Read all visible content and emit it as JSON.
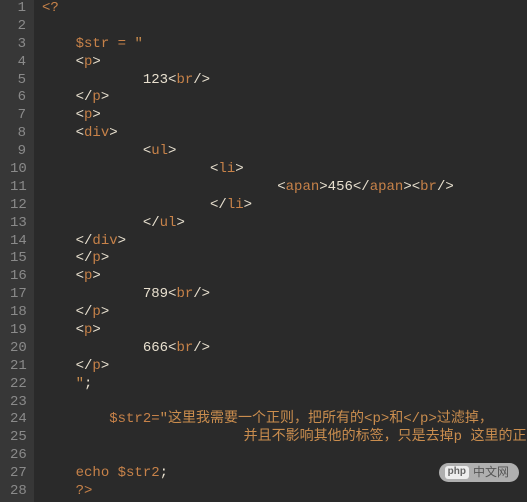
{
  "lines": [
    {
      "n": "1",
      "segments": [
        {
          "t": "<?",
          "c": "tag-name"
        }
      ],
      "indent": 0
    },
    {
      "n": "2",
      "segments": [],
      "indent": 0
    },
    {
      "n": "3",
      "segments": [
        {
          "t": "$str",
          "c": "variable"
        },
        {
          "t": " ",
          "c": ""
        },
        {
          "t": "=",
          "c": "operator"
        },
        {
          "t": " ",
          "c": ""
        },
        {
          "t": "\"",
          "c": "string"
        }
      ],
      "indent": 1
    },
    {
      "n": "4",
      "segments": [
        {
          "t": "<",
          "c": "tag-delim"
        },
        {
          "t": "p",
          "c": "tag-name"
        },
        {
          "t": ">",
          "c": "tag-delim"
        }
      ],
      "indent": 1
    },
    {
      "n": "5",
      "segments": [
        {
          "t": "123",
          "c": "num"
        },
        {
          "t": "<",
          "c": "tag-delim"
        },
        {
          "t": "br",
          "c": "tag-name"
        },
        {
          "t": "/>",
          "c": "tag-delim"
        }
      ],
      "indent": 3
    },
    {
      "n": "6",
      "segments": [
        {
          "t": "</",
          "c": "tag-delim"
        },
        {
          "t": "p",
          "c": "tag-name"
        },
        {
          "t": ">",
          "c": "tag-delim"
        }
      ],
      "indent": 1
    },
    {
      "n": "7",
      "segments": [
        {
          "t": "<",
          "c": "tag-delim"
        },
        {
          "t": "p",
          "c": "tag-name"
        },
        {
          "t": ">",
          "c": "tag-delim"
        }
      ],
      "indent": 1
    },
    {
      "n": "8",
      "segments": [
        {
          "t": "<",
          "c": "tag-delim"
        },
        {
          "t": "div",
          "c": "tag-name"
        },
        {
          "t": ">",
          "c": "tag-delim"
        }
      ],
      "indent": 1
    },
    {
      "n": "9",
      "segments": [
        {
          "t": "<",
          "c": "tag-delim"
        },
        {
          "t": "ul",
          "c": "tag-name"
        },
        {
          "t": ">",
          "c": "tag-delim"
        }
      ],
      "indent": 3
    },
    {
      "n": "10",
      "segments": [
        {
          "t": "<",
          "c": "tag-delim"
        },
        {
          "t": "li",
          "c": "tag-name"
        },
        {
          "t": ">",
          "c": "tag-delim"
        }
      ],
      "indent": 5
    },
    {
      "n": "11",
      "segments": [
        {
          "t": "<",
          "c": "tag-delim"
        },
        {
          "t": "apan",
          "c": "tag-name"
        },
        {
          "t": ">",
          "c": "tag-delim"
        },
        {
          "t": "456",
          "c": "num"
        },
        {
          "t": "</",
          "c": "tag-delim"
        },
        {
          "t": "apan",
          "c": "tag-name"
        },
        {
          "t": ">",
          "c": "tag-delim"
        },
        {
          "t": "<",
          "c": "tag-delim"
        },
        {
          "t": "br",
          "c": "tag-name"
        },
        {
          "t": "/>",
          "c": "tag-delim"
        }
      ],
      "indent": 7
    },
    {
      "n": "12",
      "segments": [
        {
          "t": "</",
          "c": "tag-delim"
        },
        {
          "t": "li",
          "c": "tag-name"
        },
        {
          "t": ">",
          "c": "tag-delim"
        }
      ],
      "indent": 5
    },
    {
      "n": "13",
      "segments": [
        {
          "t": "</",
          "c": "tag-delim"
        },
        {
          "t": "ul",
          "c": "tag-name"
        },
        {
          "t": ">",
          "c": "tag-delim"
        }
      ],
      "indent": 3
    },
    {
      "n": "14",
      "segments": [
        {
          "t": "</",
          "c": "tag-delim"
        },
        {
          "t": "div",
          "c": "tag-name"
        },
        {
          "t": ">",
          "c": "tag-delim"
        }
      ],
      "indent": 1
    },
    {
      "n": "15",
      "segments": [
        {
          "t": "</",
          "c": "tag-delim"
        },
        {
          "t": "p",
          "c": "tag-name"
        },
        {
          "t": ">",
          "c": "tag-delim"
        }
      ],
      "indent": 1
    },
    {
      "n": "16",
      "segments": [
        {
          "t": "<",
          "c": "tag-delim"
        },
        {
          "t": "p",
          "c": "tag-name"
        },
        {
          "t": ">",
          "c": "tag-delim"
        }
      ],
      "indent": 1
    },
    {
      "n": "17",
      "segments": [
        {
          "t": "789",
          "c": "num"
        },
        {
          "t": "<",
          "c": "tag-delim"
        },
        {
          "t": "br",
          "c": "tag-name"
        },
        {
          "t": "/>",
          "c": "tag-delim"
        }
      ],
      "indent": 3
    },
    {
      "n": "18",
      "segments": [
        {
          "t": "</",
          "c": "tag-delim"
        },
        {
          "t": "p",
          "c": "tag-name"
        },
        {
          "t": ">",
          "c": "tag-delim"
        }
      ],
      "indent": 1
    },
    {
      "n": "19",
      "segments": [
        {
          "t": "<",
          "c": "tag-delim"
        },
        {
          "t": "p",
          "c": "tag-name"
        },
        {
          "t": ">",
          "c": "tag-delim"
        }
      ],
      "indent": 1
    },
    {
      "n": "20",
      "segments": [
        {
          "t": "666",
          "c": "num"
        },
        {
          "t": "<",
          "c": "tag-delim"
        },
        {
          "t": "br",
          "c": "tag-name"
        },
        {
          "t": "/>",
          "c": "tag-delim"
        }
      ],
      "indent": 3
    },
    {
      "n": "21",
      "segments": [
        {
          "t": "</",
          "c": "tag-delim"
        },
        {
          "t": "p",
          "c": "tag-name"
        },
        {
          "t": ">",
          "c": "tag-delim"
        }
      ],
      "indent": 1
    },
    {
      "n": "22",
      "segments": [
        {
          "t": "\"",
          "c": "string"
        },
        {
          "t": ";",
          "c": "punct"
        }
      ],
      "indent": 1
    },
    {
      "n": "23",
      "segments": [],
      "indent": 0
    },
    {
      "n": "24",
      "segments": [
        {
          "t": "$str2",
          "c": "variable"
        },
        {
          "t": "=",
          "c": "operator"
        },
        {
          "t": "\"这里我需要一个正则，把所有的<p>和</p>过滤掉，",
          "c": "string-cjk"
        }
      ],
      "indent": 2
    },
    {
      "n": "25",
      "segments": [
        {
          "t": "并且不影响其他的标签，只是去掉p 这里的正则怎么写。\"",
          "c": "string-cjk"
        },
        {
          "t": ";",
          "c": "punct"
        }
      ],
      "indent": 6
    },
    {
      "n": "26",
      "segments": [],
      "indent": 0
    },
    {
      "n": "27",
      "segments": [
        {
          "t": "echo",
          "c": "keyword"
        },
        {
          "t": " ",
          "c": ""
        },
        {
          "t": "$str2",
          "c": "variable"
        },
        {
          "t": ";",
          "c": "punct"
        }
      ],
      "indent": 1
    },
    {
      "n": "28",
      "segments": [
        {
          "t": "?>",
          "c": "tag-name"
        }
      ],
      "indent": 1
    }
  ],
  "watermark": {
    "logo": "php",
    "text": "中文网"
  }
}
